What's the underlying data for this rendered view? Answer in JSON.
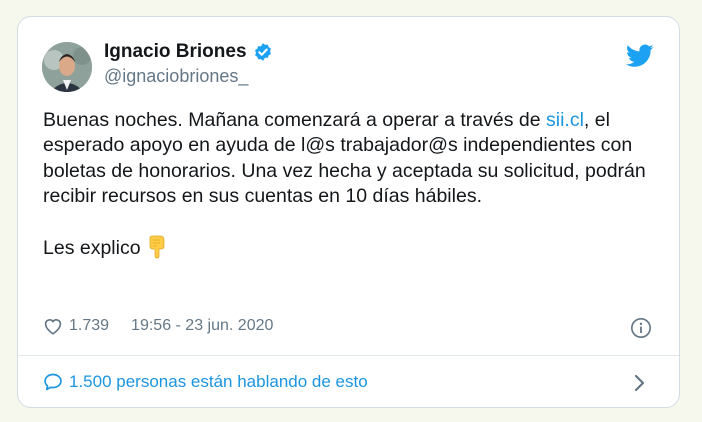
{
  "author": {
    "name": "Ignacio Briones",
    "handle": "@ignaciobriones_"
  },
  "tweet": {
    "line1_pre": "Buenas noches. Mañana comenzará a operar a través de ",
    "link": "sii.cl",
    "line1_post": ",",
    "body": "el esperado apoyo en ayuda de l@s trabajador@s independientes con boletas de honorarios. Una vez hecha y aceptada su solicitud, podrán recibir recursos en sus cuentas en 10 días hábiles.",
    "closing": "Les explico"
  },
  "meta": {
    "likes": "1.739",
    "timestamp": "19:56 - 23 jun. 2020"
  },
  "footer": {
    "conversation": "1.500 personas están hablando de esto"
  },
  "icons": {
    "verified": "verified-badge-icon",
    "bird": "twitter-bird-icon",
    "emoji": "backhand-index-pointing-down-icon",
    "heart": "heart-icon",
    "info": "info-icon",
    "bubble": "speech-bubble-icon",
    "chevron": "chevron-right-icon"
  },
  "colors": {
    "accent": "#1b95e0",
    "text": "#14171a",
    "muted": "#657786",
    "background": "#f6f8ee"
  }
}
